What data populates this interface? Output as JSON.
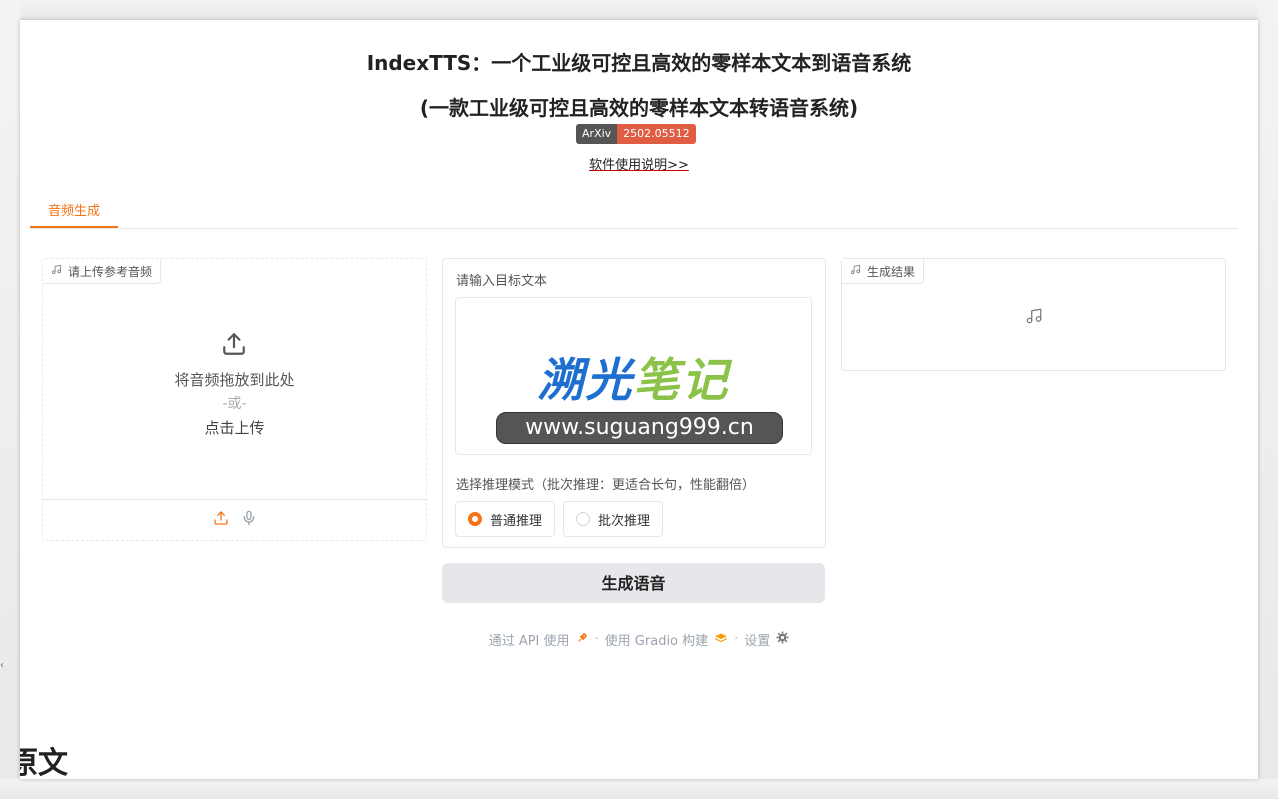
{
  "header": {
    "title_main": "IndexTTS：一个工业级可控且高效的零样本文本到语音系统",
    "title_sub": "(一款工业级可控且高效的零样本文本转语音系统)",
    "badge_left": "ArXiv",
    "badge_right": "2502.05512",
    "manual_link": "软件使用说明>>"
  },
  "tabs": [
    {
      "label": "音频生成",
      "active": true
    }
  ],
  "upload_panel": {
    "label": "请上传参考音频",
    "drop_text": "将音频拖放到此处",
    "or_text": "-或-",
    "click_text": "点击上传",
    "icons": [
      "music-note-icon",
      "upload-icon",
      "microphone-icon"
    ]
  },
  "text_panel": {
    "label": "请输入目标文本",
    "watermark_logo_part1": "溯光",
    "watermark_logo_part2": "笔记",
    "watermark_url": "www.suguang999.cn",
    "mode_label": "选择推理模式（批次推理：更适合长句，性能翻倍）",
    "modes": [
      {
        "label": "普通推理",
        "selected": true
      },
      {
        "label": "批次推理",
        "selected": false
      }
    ]
  },
  "generate_button": {
    "label": "生成语音"
  },
  "result_panel": {
    "label": "生成结果",
    "icon": "music-note-icon"
  },
  "footer": {
    "api_text": "通过 API 使用",
    "sep1": "·",
    "gradio_text": "使用 Gradio 构建",
    "sep2": "·",
    "settings_text": "设置"
  },
  "partial_heading": "原文",
  "colors": {
    "accent": "#f97316",
    "badge_dark": "#555555",
    "badge_red": "#e05d44",
    "button_bg": "#e5e7eb"
  }
}
